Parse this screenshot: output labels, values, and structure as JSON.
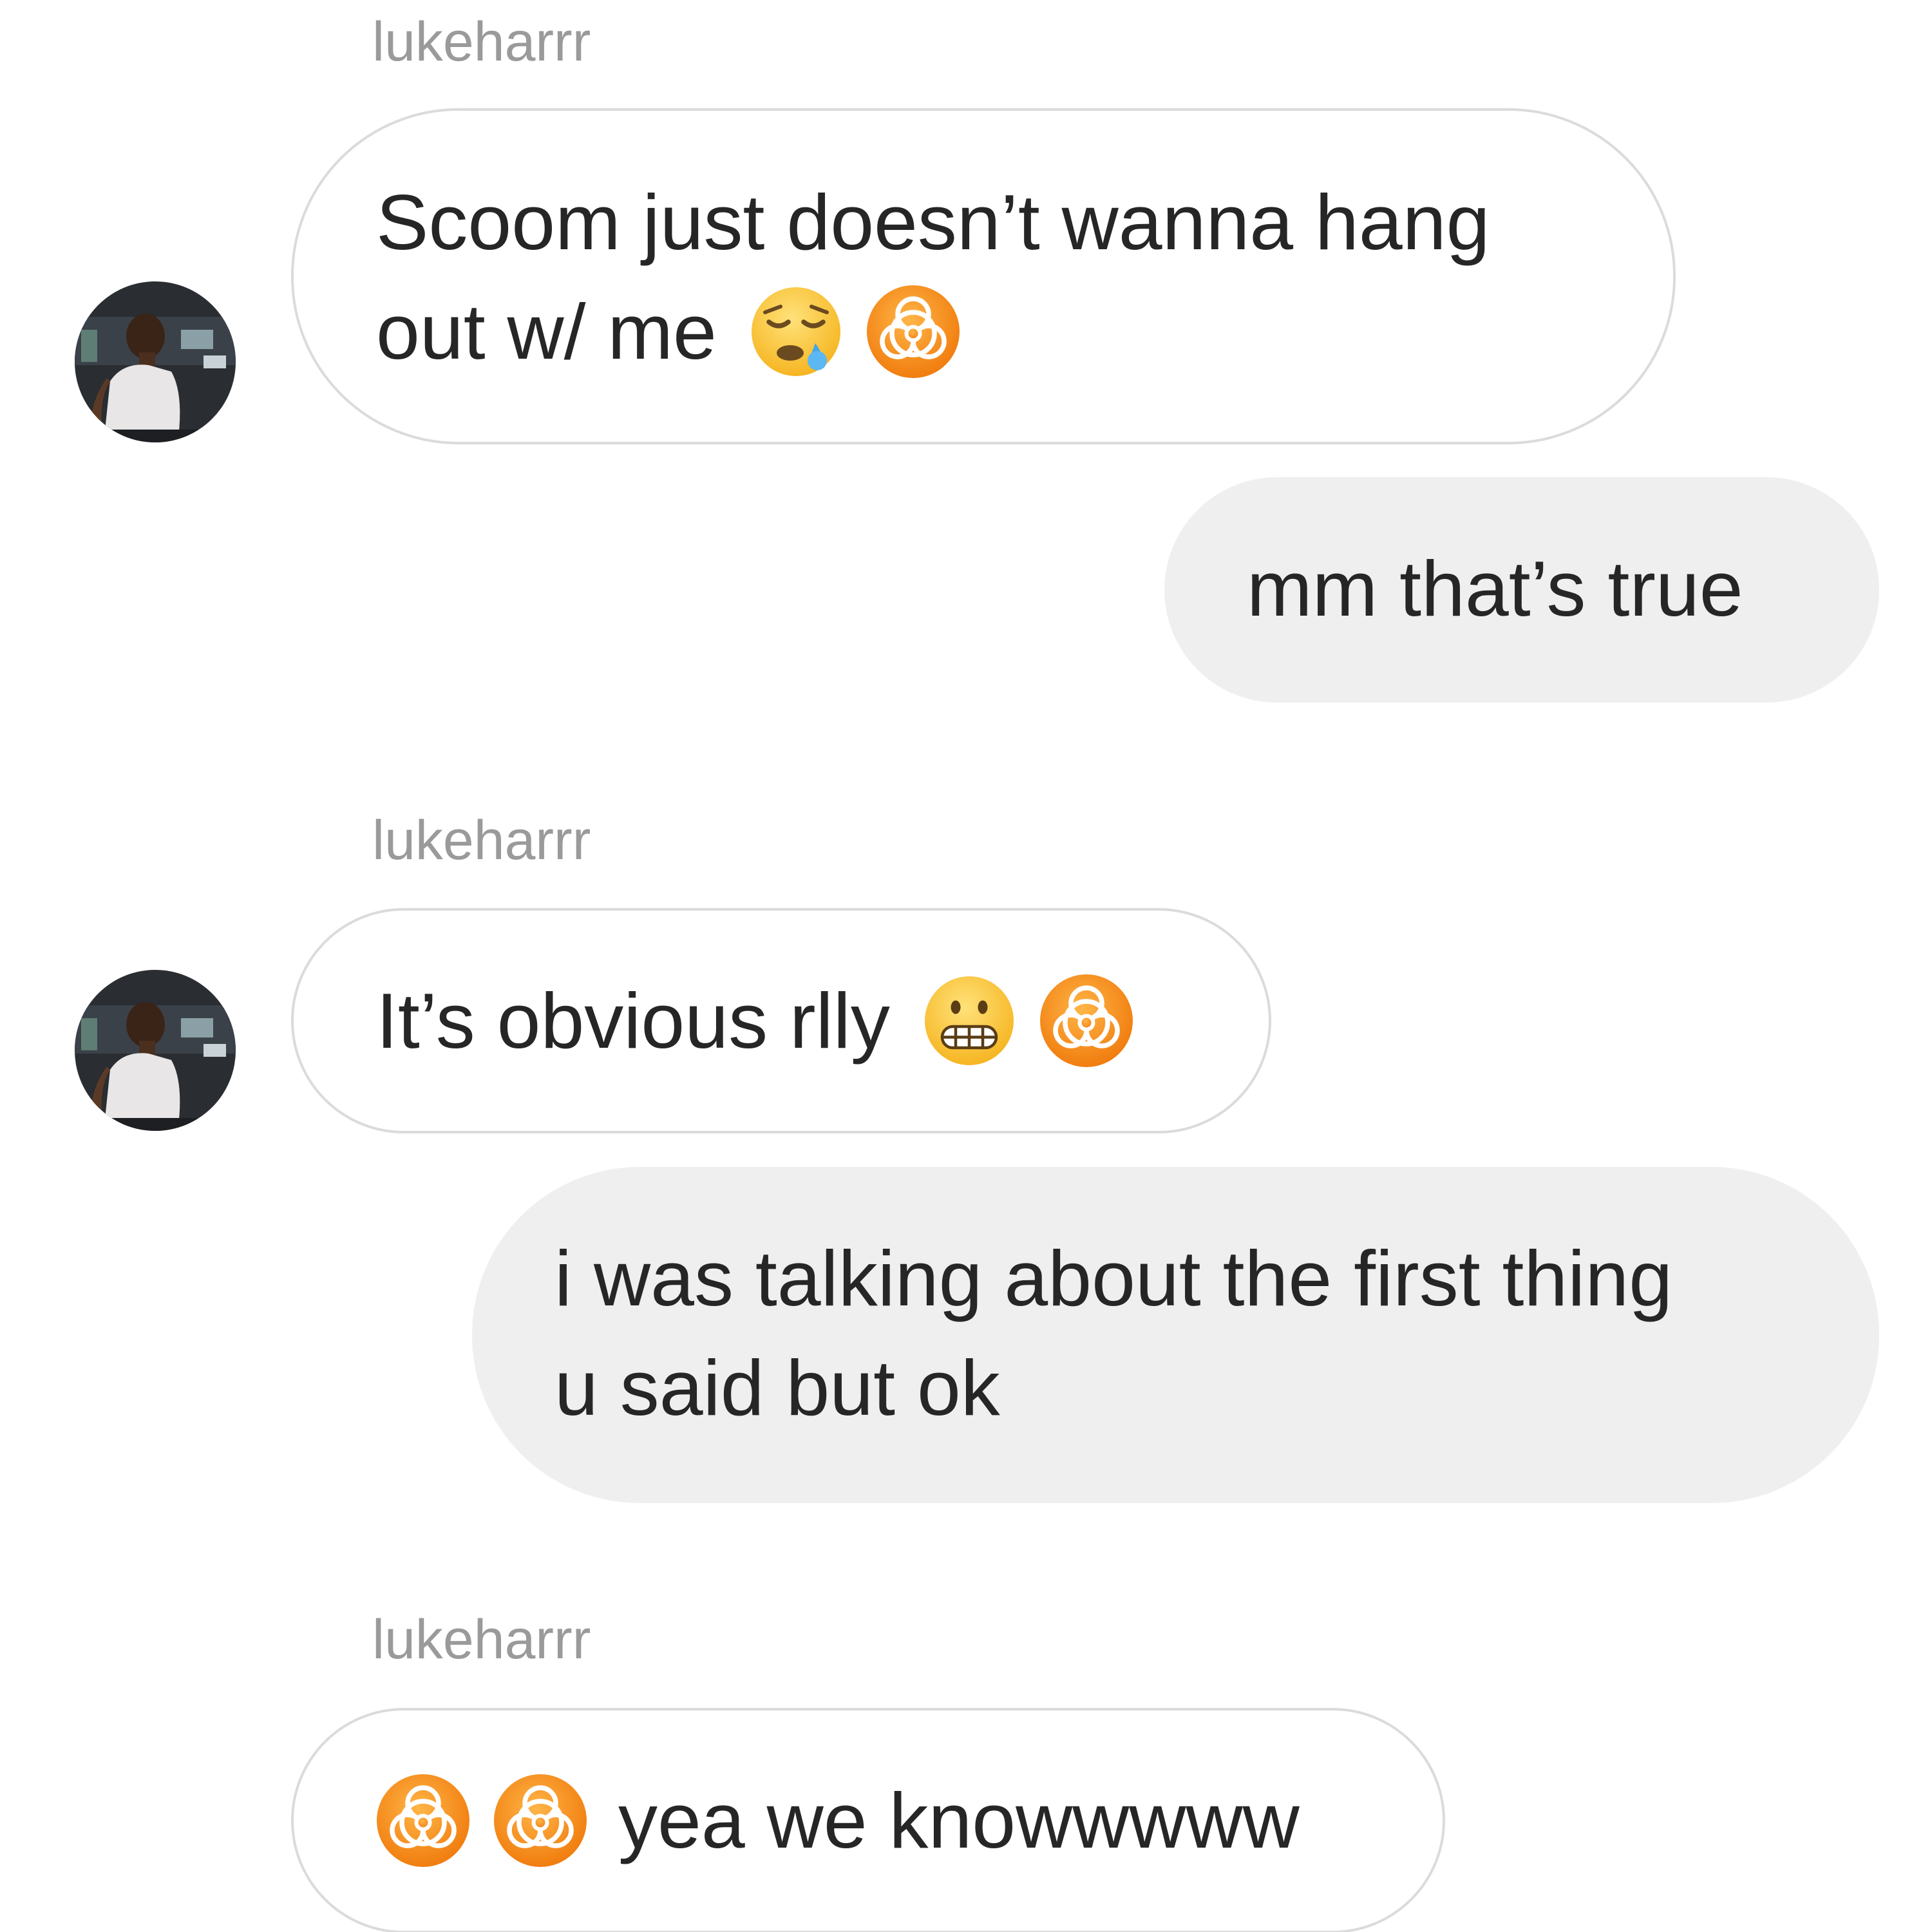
{
  "colors": {
    "incoming_bubble_border": "#dbdbdb",
    "outgoing_bubble_bg": "#efefef",
    "sender_name": "#9a9a9a",
    "text": "#262626",
    "biohazard_orange": "#f7931e"
  },
  "messages": [
    {
      "direction": "incoming",
      "sender": "lukeharrr",
      "lines": [
        "Scoom just doesn’t wanna hang",
        "out w/ me"
      ],
      "emojis": [
        "sleepy-face-icon",
        "biohazard-icon"
      ]
    },
    {
      "direction": "outgoing",
      "lines": [
        "mm that’s true"
      ]
    },
    {
      "direction": "incoming",
      "sender": "lukeharrr",
      "lines": [
        "It’s obvious rlly"
      ],
      "emojis": [
        "grimacing-face-icon",
        "biohazard-icon"
      ]
    },
    {
      "direction": "outgoing",
      "lines": [
        "i was talking about the first thing",
        "u said but ok"
      ]
    },
    {
      "direction": "incoming",
      "sender": "lukeharrr",
      "lines": [
        "yea we knowwwww"
      ],
      "emojis": [
        "biohazard-icon",
        "biohazard-icon"
      ]
    }
  ]
}
